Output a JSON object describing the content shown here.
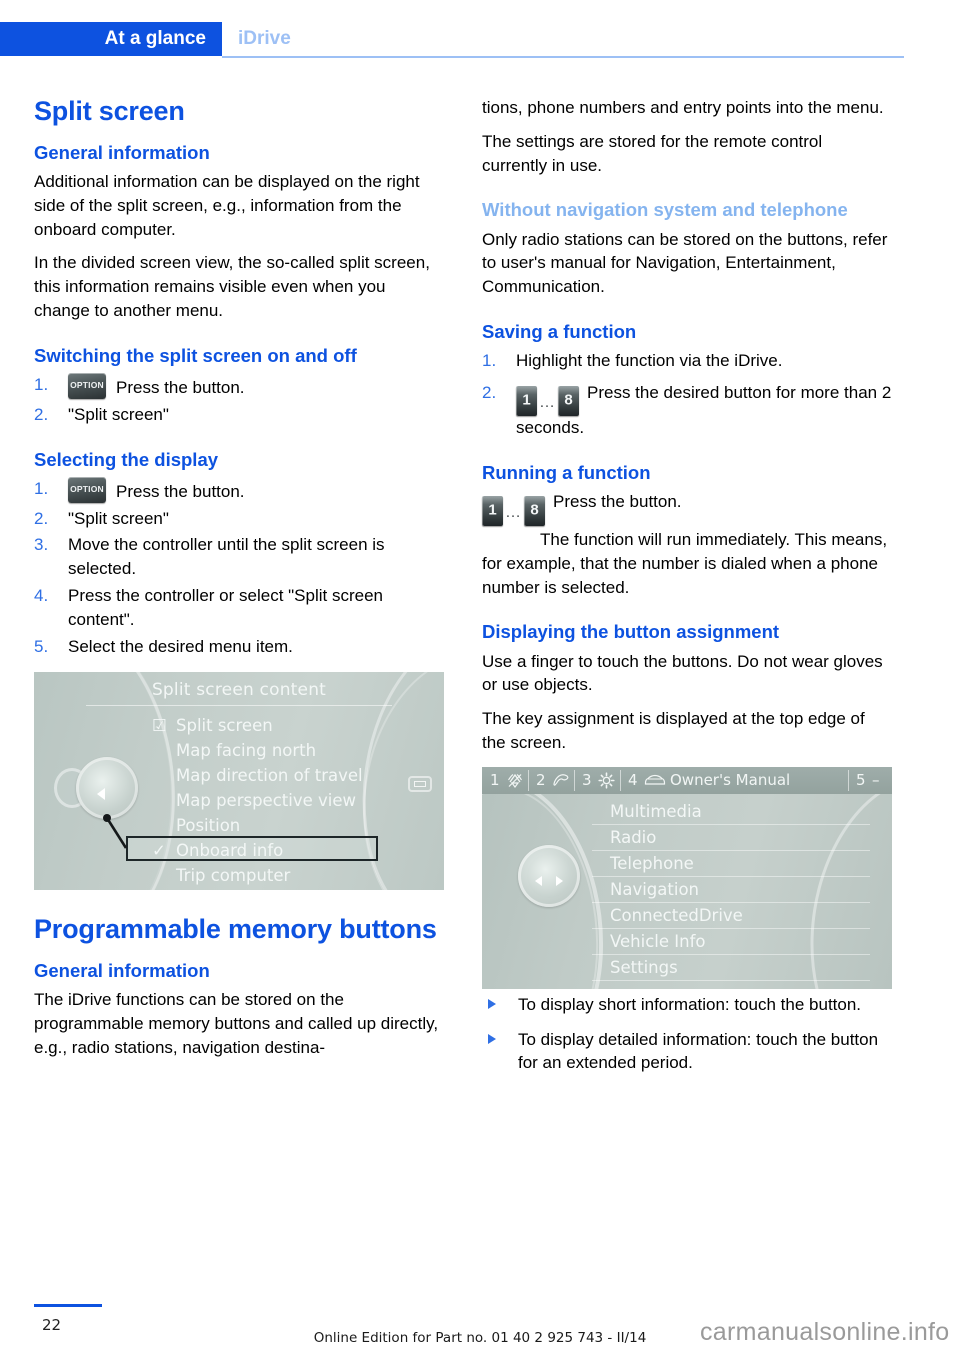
{
  "header": {
    "active_tab": "At a glance",
    "inactive_tab": "iDrive"
  },
  "left_column": {
    "title": "Split screen",
    "general_information_heading": "General information",
    "general_p1": "Additional information can be displayed on the right side of the split screen, e.g., information from the onboard computer.",
    "general_p2": "In the divided screen view, the so-called split screen, this information remains visible even when you change to another menu.",
    "switching_heading": "Switching the split screen on and off",
    "switching_steps": [
      {
        "num": "1.",
        "icon": "option-button-icon",
        "text": "Press the button."
      },
      {
        "num": "2.",
        "icon": "",
        "text": "\"Split screen\""
      }
    ],
    "selecting_heading": "Selecting the display",
    "selecting_steps": [
      {
        "num": "1.",
        "icon": "option-button-icon",
        "text": "Press the button."
      },
      {
        "num": "2.",
        "icon": "",
        "text": "\"Split screen\""
      },
      {
        "num": "3.",
        "icon": "",
        "text": "Move the controller until the split screen is selected."
      },
      {
        "num": "4.",
        "icon": "",
        "text": "Press the controller or select \"Split screen content\"."
      },
      {
        "num": "5.",
        "icon": "",
        "text": "Select the desired menu item."
      }
    ],
    "option_button_label": "OPTION",
    "idrive_screenshot_1": {
      "title": "Split screen content",
      "items": [
        {
          "mark": "checkbox-checked",
          "label": "Split screen",
          "highlighted": false
        },
        {
          "mark": "",
          "label": "Map facing north",
          "highlighted": false
        },
        {
          "mark": "",
          "label": "Map direction of travel",
          "highlighted": false
        },
        {
          "mark": "",
          "label": "Map perspective view",
          "highlighted": false
        },
        {
          "mark": "",
          "label": "Position",
          "highlighted": false
        },
        {
          "mark": "check",
          "label": "Onboard info",
          "highlighted": true
        },
        {
          "mark": "",
          "label": "Trip computer",
          "highlighted": false
        }
      ]
    },
    "memory_title": "Programmable memory buttons",
    "memory_general_heading": "General information",
    "memory_p1": "The iDrive functions can be stored on the programmable memory buttons and called up directly, e.g., radio stations, navigation destina-"
  },
  "right_column": {
    "continued_p1": "tions, phone numbers and entry points into the menu.",
    "continued_p2": "The settings are stored for the remote control currently in use.",
    "without_nav_heading": "Without navigation system and telephone",
    "without_nav_p1": "Only radio stations can be stored on the buttons, refer to user's manual for Navigation, Entertainment, Communication.",
    "saving_heading": "Saving a function",
    "saving_steps": [
      {
        "num": "1.",
        "icon": "",
        "text": "Highlight the function via the iDrive."
      },
      {
        "num": "2.",
        "icon": "memory-buttons-icon",
        "text": "Press the desired button for more than 2 seconds."
      }
    ],
    "running_heading": "Running a function",
    "running_line1": "Press the button.",
    "running_line2": "The function will run immediately. This means, for example, that the number is dialed when a phone number is selected.",
    "memory_button_first": "1",
    "memory_button_last": "8",
    "memory_button_ellipsis": "…",
    "displaying_heading": "Displaying the button assignment",
    "displaying_p1": "Use a finger to touch the buttons. Do not wear gloves or use objects.",
    "displaying_p2": "The key assignment is displayed at the top edge of the screen.",
    "idrive_screenshot_2": {
      "topbar": [
        {
          "number": "1",
          "icon": "antenna-icon",
          "label": ""
        },
        {
          "number": "2",
          "icon": "phone-icon",
          "label": ""
        },
        {
          "number": "3",
          "icon": "gear-icon",
          "label": ""
        },
        {
          "number": "4",
          "icon": "car-icon",
          "label": "Owner's Manual"
        },
        {
          "number": "5",
          "icon": "",
          "label": "–"
        }
      ],
      "items": [
        "Multimedia",
        "Radio",
        "Telephone",
        "Navigation",
        "ConnectedDrive",
        "Vehicle Info",
        "Settings"
      ]
    },
    "touch_bullets": [
      "To display short information: touch the button.",
      "To display detailed information: touch the button for an extended period."
    ]
  },
  "footer": {
    "page_number": "22",
    "edition": "Online Edition for Part no. 01 40 2 925 743 - II/14",
    "watermark": "carmanualsonline.info"
  },
  "colors": {
    "accent_blue": "#0d52e0",
    "light_blue": "#85b4ef",
    "tab_inactive": "#9dc0f5",
    "idrive_bg": "#c2cdc9"
  }
}
